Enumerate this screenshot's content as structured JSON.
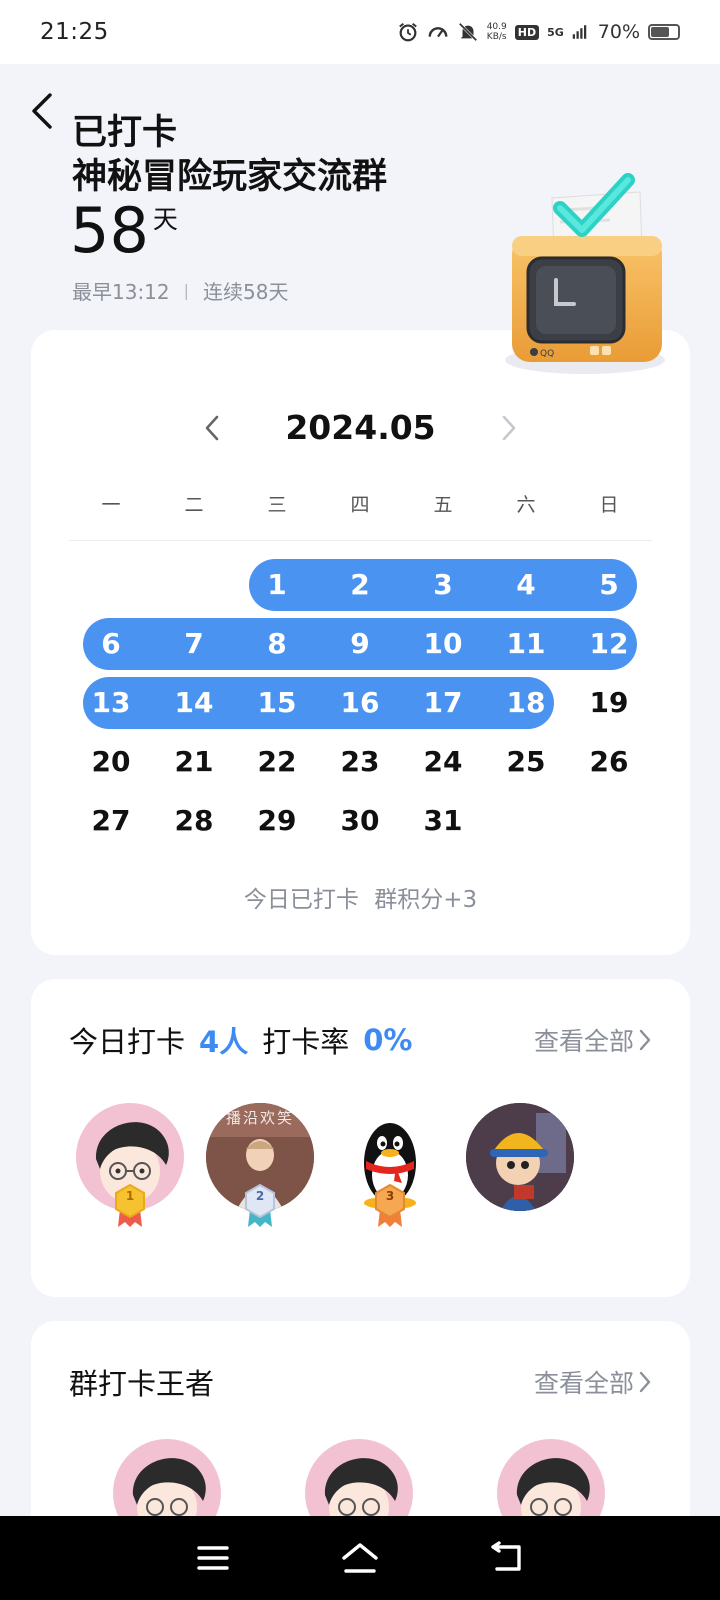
{
  "status_bar": {
    "time": "21:25",
    "net_speed_value": "40.9",
    "net_speed_unit": "KB/s",
    "hd": "HD",
    "network": "5G",
    "battery": "70%",
    "battery_level": 0.7
  },
  "header": {
    "status": "已打卡",
    "group_name": "神秘冒险玩家交流群",
    "days": "58",
    "days_unit": "天",
    "earliest": "最早13:12",
    "separator": "|",
    "streak": "连续58天"
  },
  "calendar": {
    "month_label": "2024.05",
    "weekdays": [
      "一",
      "二",
      "三",
      "四",
      "五",
      "六",
      "日"
    ],
    "first_weekday_index": 2,
    "days_in_month": 31,
    "checked_days": [
      1,
      2,
      3,
      4,
      5,
      6,
      7,
      8,
      9,
      10,
      11,
      12,
      13,
      14,
      15,
      16,
      17,
      18
    ],
    "today_tip": "今日已打卡 群积分+3",
    "accent_color": "#4b93f0"
  },
  "today_checkin": {
    "label": "今日打卡",
    "count": "4人",
    "rate_label": "打卡率",
    "rate": "0%",
    "view_all": "查看全部",
    "ranks": [
      "1",
      "2",
      "3"
    ],
    "avatar_photo_text": "播沿欢笑"
  },
  "king": {
    "title": "群打卡王者",
    "view_all": "查看全部"
  },
  "colors": {
    "accent": "#3d8bf2",
    "background": "#f2f4f9",
    "muted_text": "#8a8f99"
  }
}
